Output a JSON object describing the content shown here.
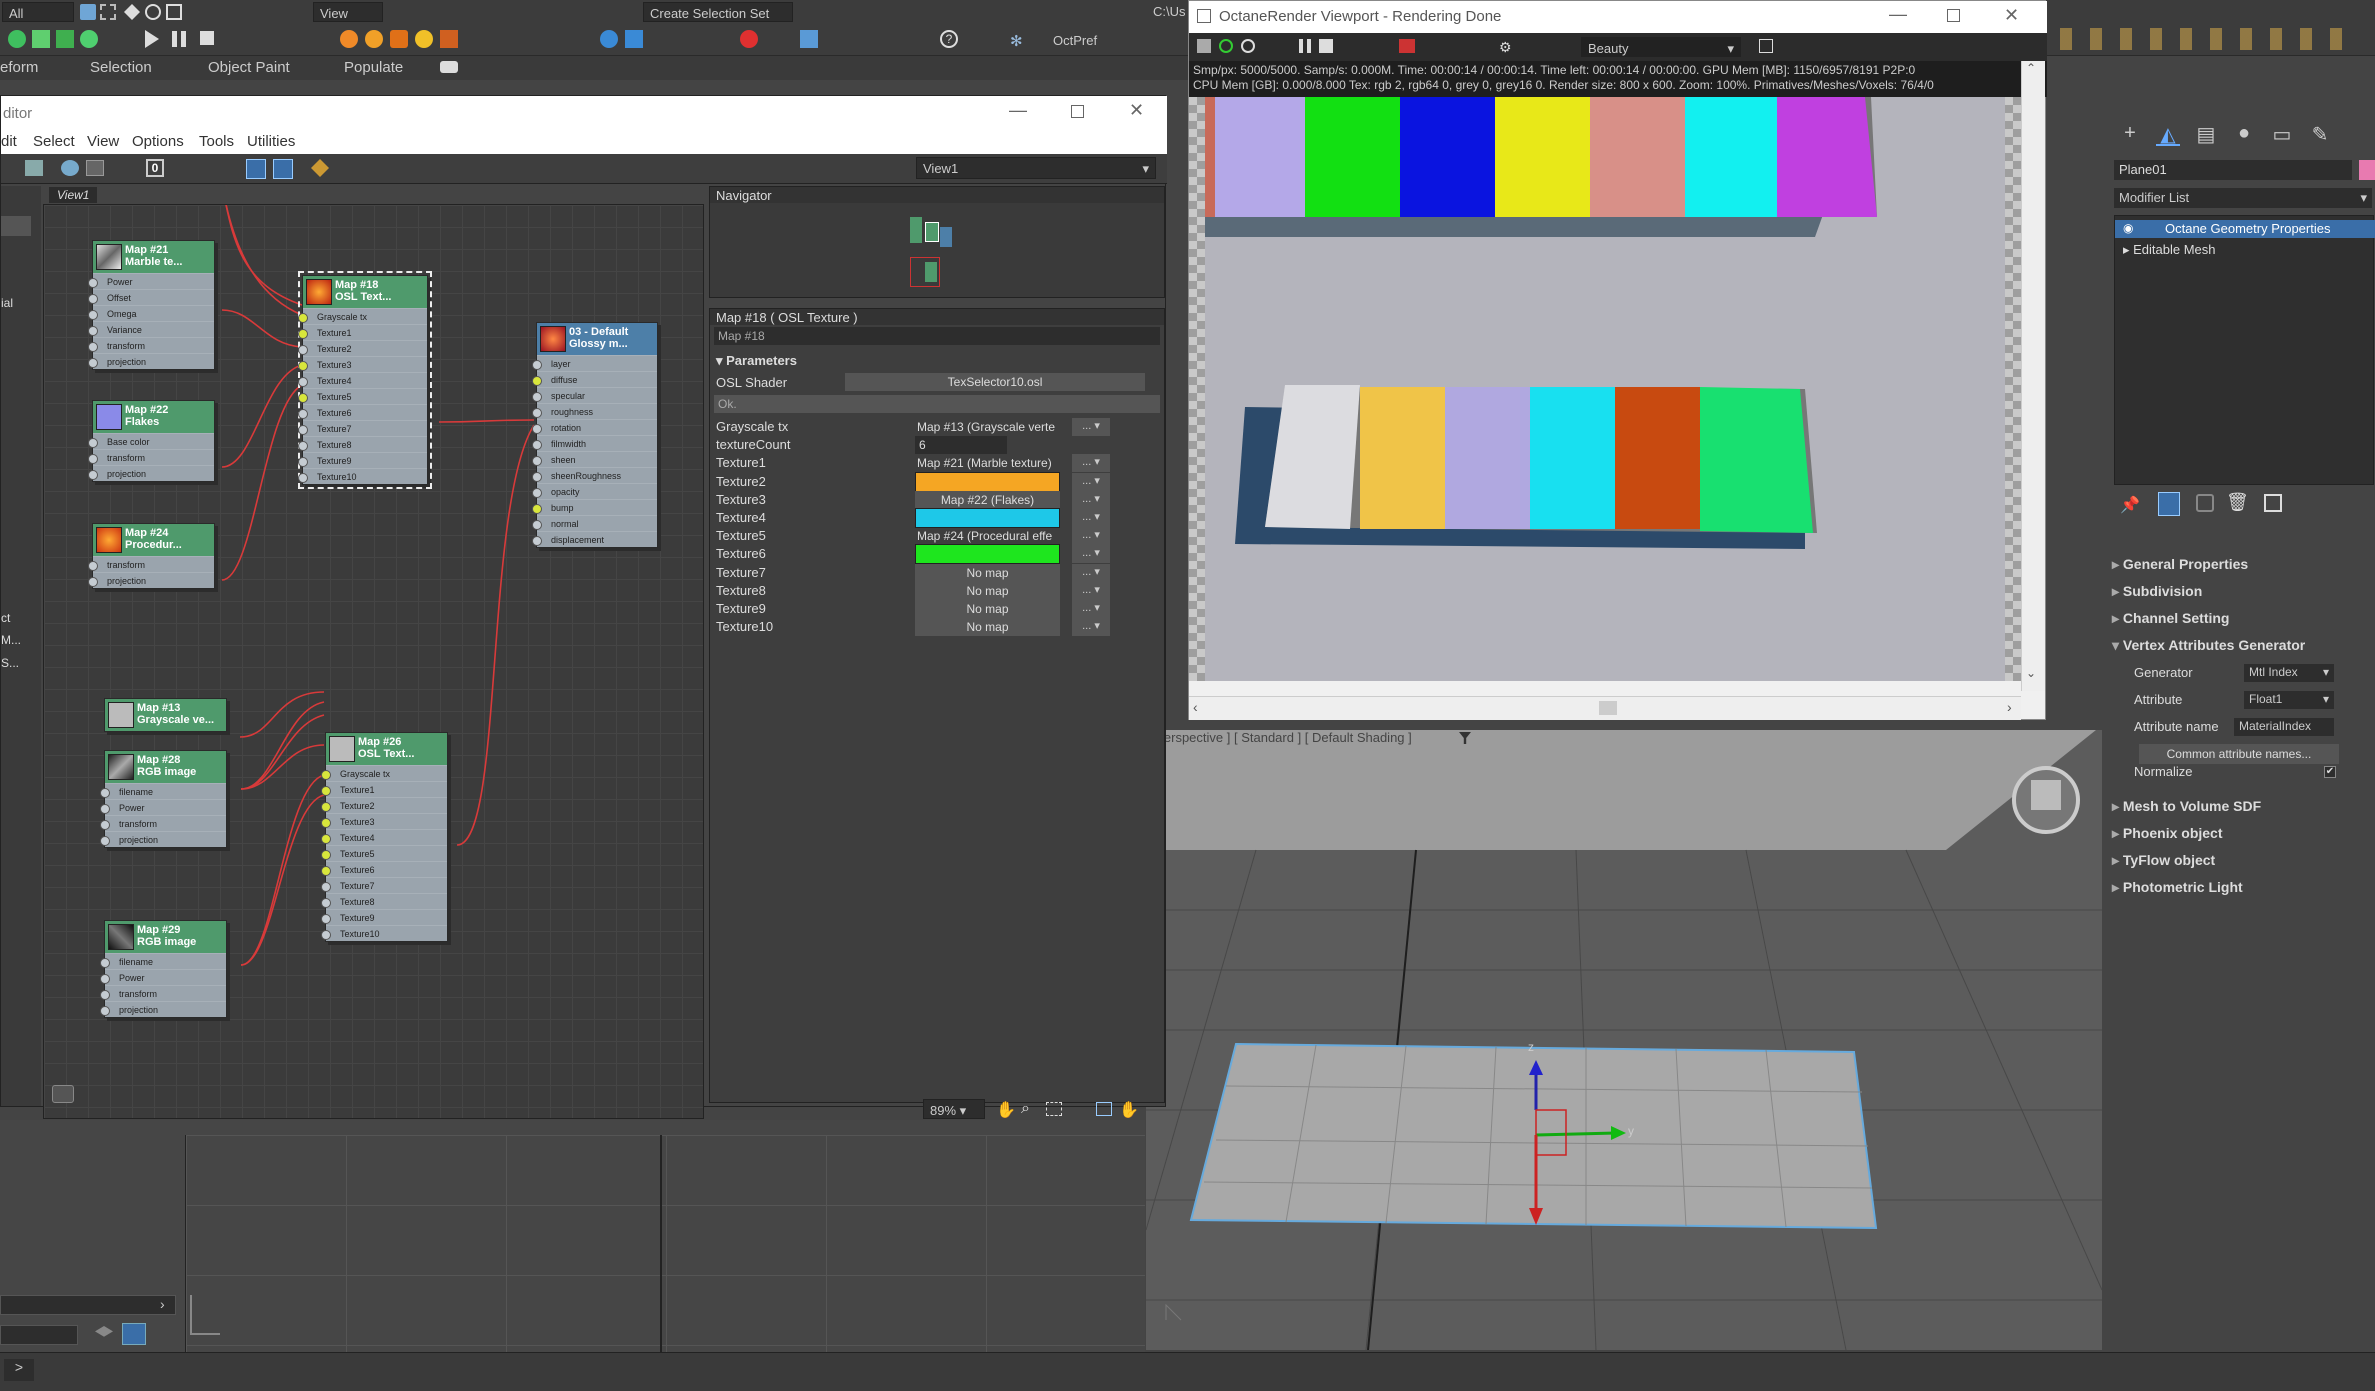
{
  "toolbar": {
    "selection_filter": "All",
    "view_dropdown": "View",
    "create_selection_set": "Create Selection Set",
    "path_fragment": "C:\\Us",
    "plugin_label": "OctPref"
  },
  "ribbon": {
    "items": [
      "eform",
      "Selection",
      "Object Paint",
      "Populate"
    ]
  },
  "material_editor": {
    "title_fragment": "ditor",
    "menu": [
      "dit",
      "Select",
      "View",
      "Options",
      "Tools",
      "Utilities"
    ],
    "view_dropdown": "View1",
    "view_tab": "View1",
    "left_strip_labels": [
      "ial",
      "ct",
      "M...",
      "S..."
    ],
    "nodes": [
      {
        "id": "map21",
        "title": "Map #21",
        "subtitle": "Marble te...",
        "slots": [
          "Power",
          "Offset",
          "Omega",
          "Variance",
          "transform",
          "projection"
        ]
      },
      {
        "id": "map22",
        "title": "Map #22",
        "subtitle": "Flakes",
        "slots": [
          "Base color",
          "transform",
          "projection"
        ]
      },
      {
        "id": "map24",
        "title": "Map #24",
        "subtitle": "Procedur...",
        "slots": [
          "transform",
          "projection"
        ]
      },
      {
        "id": "map18",
        "title": "Map #18",
        "subtitle": "OSL Text...",
        "slots": [
          "Grayscale tx",
          "Texture1",
          "Texture2",
          "Texture3",
          "Texture4",
          "Texture5",
          "Texture6",
          "Texture7",
          "Texture8",
          "Texture9",
          "Texture10"
        ]
      },
      {
        "id": "mat03",
        "title": "03 - Default",
        "subtitle": "Glossy m...",
        "slots": [
          "layer",
          "diffuse",
          "specular",
          "roughness",
          "rotation",
          "filmwidth",
          "sheen",
          "sheenRoughness",
          "opacity",
          "bump",
          "normal",
          "displacement"
        ]
      },
      {
        "id": "map13",
        "title": "Map #13",
        "subtitle": "Grayscale ve...",
        "slots": []
      },
      {
        "id": "map28",
        "title": "Map #28",
        "subtitle": "RGB image",
        "slots": [
          "filename",
          "Power",
          "transform",
          "projection"
        ]
      },
      {
        "id": "map26",
        "title": "Map #26",
        "subtitle": "OSL Text...",
        "slots": [
          "Grayscale tx",
          "Texture1",
          "Texture2",
          "Texture3",
          "Texture4",
          "Texture5",
          "Texture6",
          "Texture7",
          "Texture8",
          "Texture9",
          "Texture10"
        ]
      },
      {
        "id": "map29",
        "title": "Map #29",
        "subtitle": "RGB image",
        "slots": [
          "filename",
          "Power",
          "transform",
          "projection"
        ]
      }
    ],
    "navigator_title": "Navigator",
    "params_title": "Map #18  ( OSL Texture )",
    "params_name": "Map #18",
    "params_rollout": "Parameters",
    "osl_shader_label": "OSL Shader",
    "osl_shader_value": "TexSelector10.osl",
    "ok_label": "Ok.",
    "rows": [
      {
        "label": "Grayscale tx",
        "kind": "text",
        "value": "Map #13 (Grayscale verte"
      },
      {
        "label": "textureCount",
        "kind": "spin",
        "value": "6"
      },
      {
        "label": "Texture1",
        "kind": "text",
        "value": "Map #21 (Marble texture)"
      },
      {
        "label": "Texture2",
        "kind": "color",
        "color": "#f5a623"
      },
      {
        "label": "Texture3",
        "kind": "button",
        "value": "Map #22 (Flakes)"
      },
      {
        "label": "Texture4",
        "kind": "color",
        "color": "#1ec8e8"
      },
      {
        "label": "Texture5",
        "kind": "text",
        "value": "Map #24 (Procedural effe"
      },
      {
        "label": "Texture6",
        "kind": "color",
        "color": "#1ee61e"
      },
      {
        "label": "Texture7",
        "kind": "button",
        "value": "No map"
      },
      {
        "label": "Texture8",
        "kind": "button",
        "value": "No map"
      },
      {
        "label": "Texture9",
        "kind": "button",
        "value": "No map"
      },
      {
        "label": "Texture10",
        "kind": "button",
        "value": "No map"
      }
    ],
    "dropdown_button": "...",
    "zoom": "89%"
  },
  "octane": {
    "title": "OctaneRender Viewport - Rendering Done",
    "pass_dropdown": "Beauty",
    "info_line1": "Smp/px: 5000/5000.  Samp/s: 0.000M.  Time: 00:00:14 / 00:00:14.  Time left: 00:00:14 / 00:00:00.  GPU Mem [MB]: 1150/6957/8191 P2P:0",
    "info_line2": "CPU Mem [GB]: 0.000/8.000  Tex: rgb 2, rgb64 0, grey 0, grey16 0.  Render size: 800 x 600.  Zoom: 100%.  Primatives/Meshes/Voxels: 76/4/0"
  },
  "viewport": {
    "label": "[ Perspective ] [ Standard ] [ Default Shading ]",
    "axis_y": "y",
    "axis_z": "z"
  },
  "command_panel": {
    "object_name": "Plane01",
    "modifier_list": "Modifier List",
    "stack": [
      "Octane Geometry Properties",
      "Editable Mesh"
    ],
    "sections": [
      "General Properties",
      "Subdivision",
      "Channel Setting",
      "Vertex Attributes Generator",
      "Mesh to Volume SDF",
      "Phoenix object",
      "TyFlow object",
      "Photometric Light"
    ],
    "generator_label": "Generator",
    "generator_value": "Mtl Index",
    "attribute_label": "Attribute",
    "attribute_value": "Float1",
    "attribute_name_label": "Attribute name",
    "attribute_name_value": "MaterialIndex",
    "common_names_button": "Common attribute names...",
    "normalize_label": "Normalize"
  }
}
